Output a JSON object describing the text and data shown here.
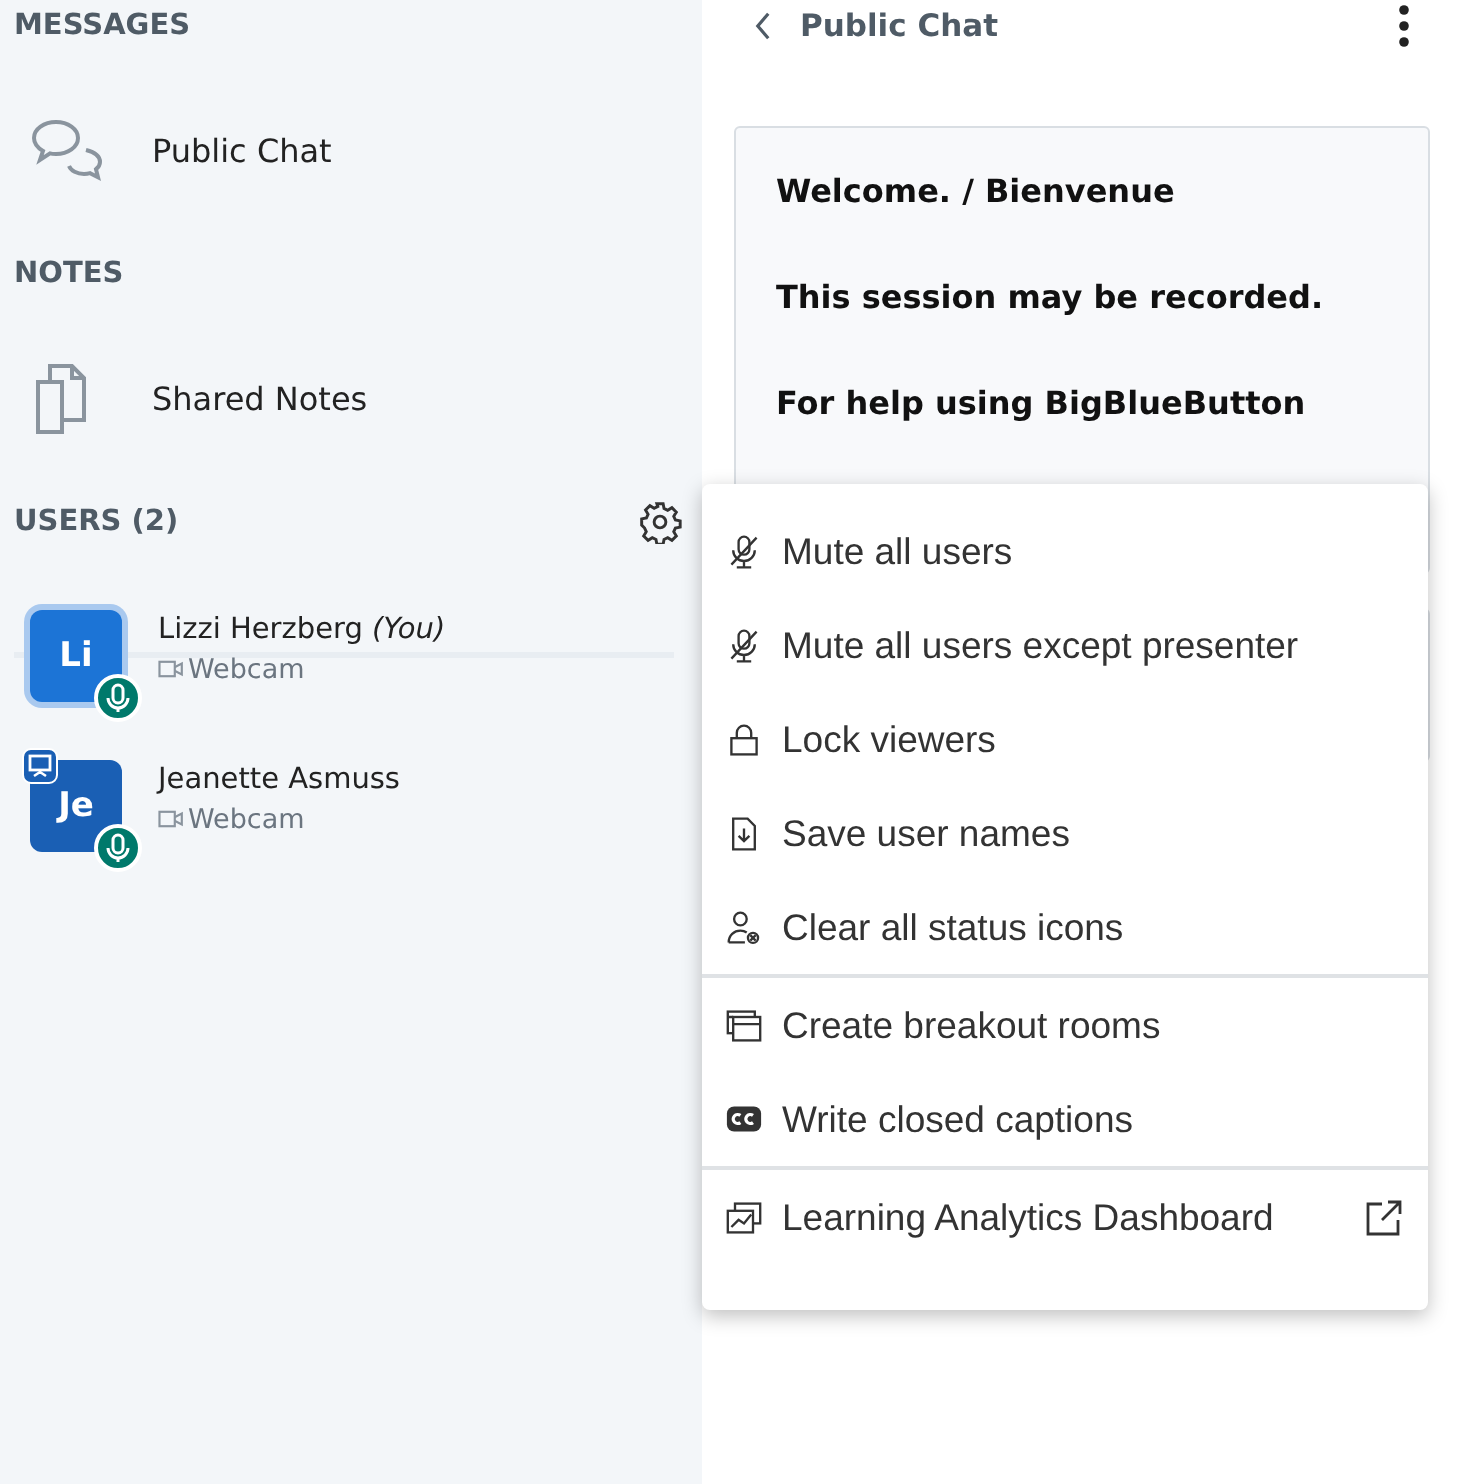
{
  "sidebar": {
    "sections": [
      {
        "title": "MESSAGES",
        "items": [
          {
            "kind": "chat",
            "label": "Public Chat"
          }
        ]
      },
      {
        "title": "NOTES",
        "items": [
          {
            "kind": "notes",
            "label": "Shared Notes"
          }
        ]
      }
    ],
    "users": {
      "title": "USERS (2)",
      "list": [
        {
          "initials": "Li",
          "name": "Lizzi Herzberg *(You)*",
          "status": "Webcam",
          "color": "#1c74d6",
          "current": true,
          "presenter": false,
          "mic": true
        },
        {
          "initials": "Je",
          "name": "Jeanette Asmuss",
          "status": "Webcam",
          "color": "#1a5fb4",
          "current": false,
          "presenter": true,
          "mic": true
        }
      ]
    }
  },
  "chat": {
    "title": "Public Chat",
    "messages": [
      "Welcome. / Bienvenue",
      "This session may be recorded.",
      "For help using BigBlueButton"
    ]
  },
  "menu": {
    "groups": [
      [
        {
          "kind": "mic-off",
          "label": "Mute all users"
        },
        {
          "kind": "mic-off",
          "label": "Mute all users except presenter"
        },
        {
          "kind": "lock",
          "label": "Lock viewers"
        },
        {
          "kind": "download",
          "label": "Save user names"
        },
        {
          "kind": "user-clear",
          "label": "Clear all status icons"
        }
      ],
      [
        {
          "kind": "rooms",
          "label": "Create breakout rooms"
        },
        {
          "kind": "cc",
          "label": "Write closed captions"
        }
      ],
      [
        {
          "kind": "chart",
          "label": "Learning Analytics Dashboard",
          "external": true
        }
      ]
    ]
  }
}
